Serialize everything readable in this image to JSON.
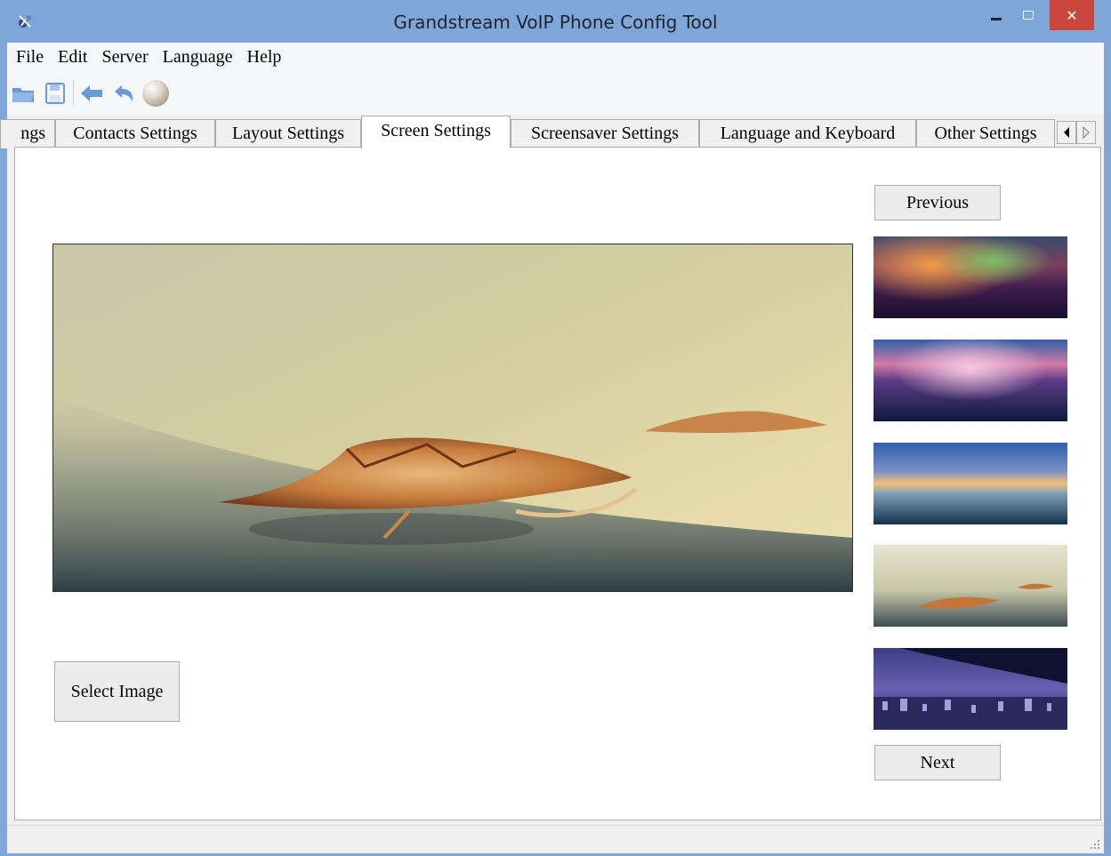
{
  "window": {
    "title": "Grandstream VoIP Phone Config Tool",
    "close_glyph": "✕"
  },
  "menu": [
    "File",
    "Edit",
    "Server",
    "Language",
    "Help"
  ],
  "toolbar_icons": [
    "open-folder-icon",
    "save-icon",
    "back-arrow-icon",
    "undo-icon",
    "sphere-icon"
  ],
  "tabs": [
    {
      "label": "ngs"
    },
    {
      "label": "Contacts Settings"
    },
    {
      "label": "Layout Settings"
    },
    {
      "label": "Screen Settings",
      "active": true
    },
    {
      "label": "Screensaver Settings"
    },
    {
      "label": "Language and Keyboard"
    },
    {
      "label": "Other Settings"
    }
  ],
  "buttons": {
    "previous": "Previous",
    "next": "Next",
    "select_image": "Select Image"
  },
  "thumbnails": [
    "purple-orange-blur",
    "pink-blue-blur",
    "sunset-horizon-blur",
    "autumn-leaf",
    "city-night-skyline"
  ],
  "colors": {
    "titlebar": "#7fa6d8",
    "close_button": "#c9463d"
  }
}
